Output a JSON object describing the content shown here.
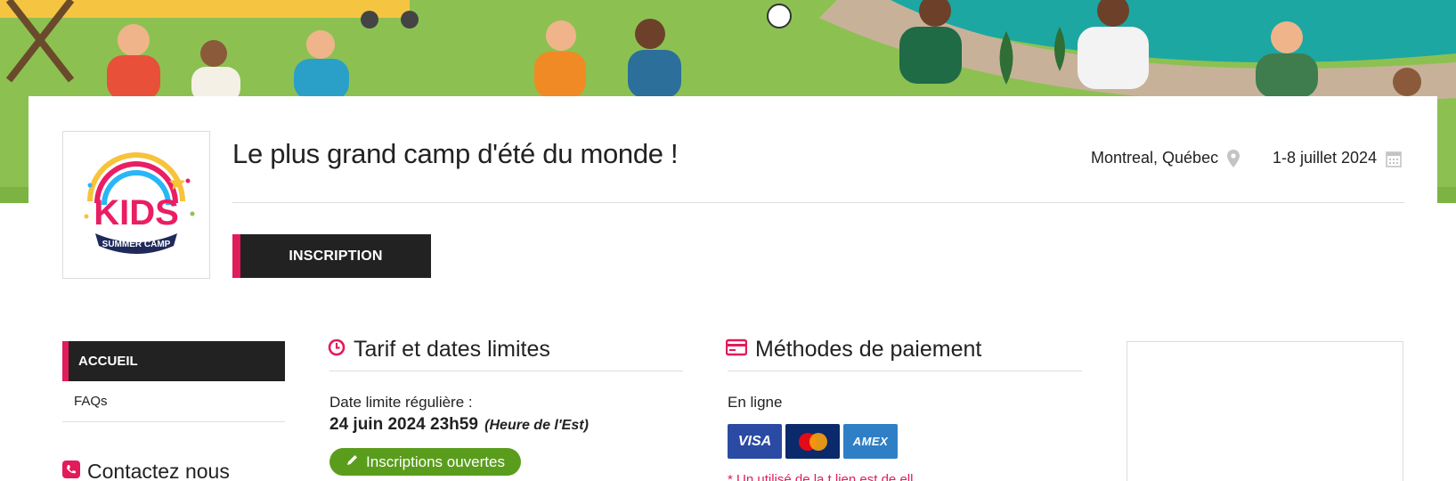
{
  "banner": {
    "description_icon": "summer-camp-illustration"
  },
  "event": {
    "title": "Le plus grand camp d'été du monde !",
    "location": "Montreal, Québec",
    "dates": "1-8 juillet 2024"
  },
  "logo": {
    "line1": "KIDS",
    "line2": "SUMMER CAMP"
  },
  "tabs": {
    "inscription": "INSCRIPTION"
  },
  "sidebar": {
    "items": [
      {
        "label": "ACCUEIL",
        "active": true
      },
      {
        "label": "FAQs",
        "active": false
      }
    ],
    "contact": "Contactez nous"
  },
  "tarif": {
    "heading": "Tarif et dates limites",
    "label": "Date limite régulière :",
    "deadline": "24 juin 2024 23h59",
    "timezone": "(Heure de l'Est)",
    "status": "Inscriptions ouvertes"
  },
  "payment": {
    "heading": "Méthodes de paiement",
    "online_label": "En ligne",
    "cards": [
      "VISA",
      "MasterCard",
      "AMEX"
    ],
    "note": "* Un utilisé de la t lien est de ell"
  },
  "colors": {
    "accent": "#e21b5a",
    "dark": "#222222",
    "success": "#5a9d1c",
    "visa": "#2a4aa3",
    "mastercard": "#0a2a6b",
    "amex": "#2f7fc6"
  }
}
